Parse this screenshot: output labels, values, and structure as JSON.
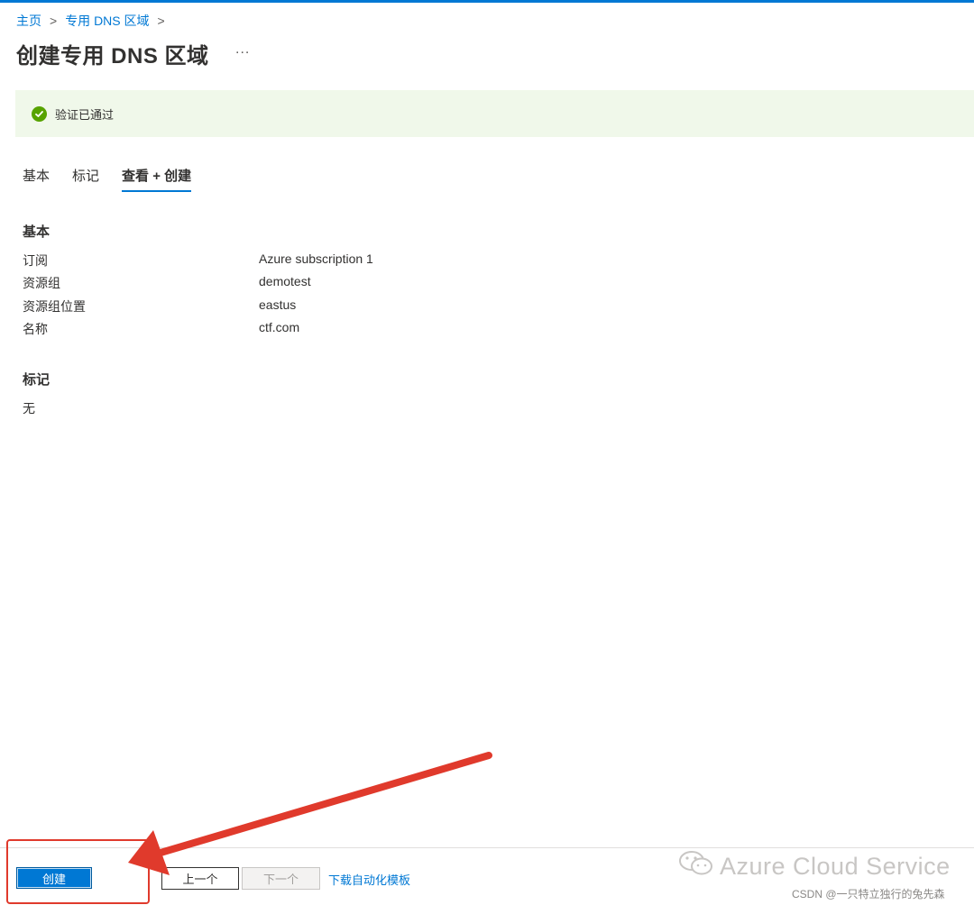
{
  "breadcrumb": {
    "home": "主页",
    "parent": "专用 DNS 区域",
    "sep": ">"
  },
  "page": {
    "title": "创建专用 DNS 区域",
    "more": "..."
  },
  "validation": {
    "text": "验证已通过"
  },
  "tabs": [
    {
      "label": "基本",
      "active": false
    },
    {
      "label": "标记",
      "active": false
    },
    {
      "label": "查看 + 创建",
      "active": true
    }
  ],
  "basics": {
    "title": "基本",
    "rows": [
      {
        "label": "订阅",
        "value": "Azure subscription 1"
      },
      {
        "label": "资源组",
        "value": "demotest"
      },
      {
        "label": "资源组位置",
        "value": "eastus"
      },
      {
        "label": "名称",
        "value": "ctf.com"
      }
    ]
  },
  "tags": {
    "title": "标记",
    "value": "无"
  },
  "footer": {
    "create_label": "创建",
    "prev_label": "上一个",
    "next_label": "下一个",
    "download_label": "下载自动化模板"
  },
  "watermark": {
    "brand": "Azure Cloud Service",
    "csdn": "CSDN @一只特立独行的兔先森"
  },
  "colors": {
    "accent": "#0078d4",
    "success": "#57a300",
    "annotation": "#e03a2c"
  },
  "icons": {
    "validation": "check-circle-icon",
    "wechat": "wechat-icon",
    "annotation": "red-arrow"
  }
}
